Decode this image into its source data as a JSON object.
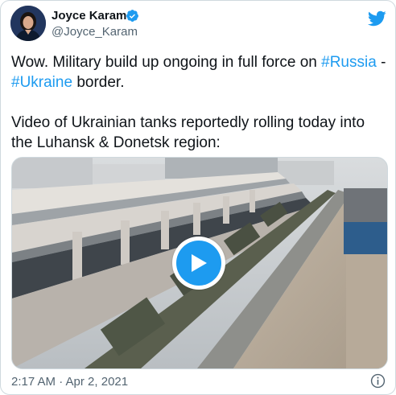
{
  "author": {
    "name": "Joyce Karam",
    "handle": "@Joyce_Karam",
    "verified": true
  },
  "tweet": {
    "line1_pre": "Wow. Military build up ongoing in full force on",
    "hashtag_russia": "#Russia",
    "separator": " - ",
    "hashtag_ukraine": "#Ukraine",
    "line2_post": " border.",
    "paragraph2": "Video of Ukrainian tanks reportedly rolling today into the Luhansk & Donetsk region:"
  },
  "meta": {
    "timestamp": "2:17 AM · Apr 2, 2021"
  },
  "icons": {
    "brand": "twitter-bird-icon",
    "verified": "verified-badge-icon",
    "play": "play-icon",
    "info": "info-icon"
  },
  "colors": {
    "accent": "#1d9bf0",
    "text": "#0f1419",
    "secondary": "#536471",
    "border": "#cfd9de"
  }
}
